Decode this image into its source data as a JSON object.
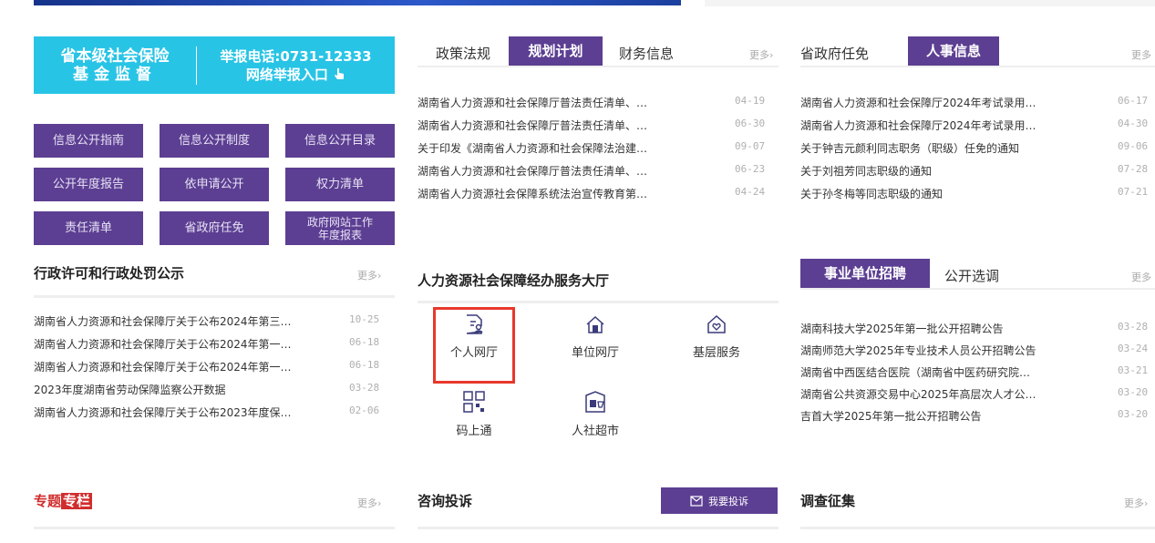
{
  "fund": {
    "line1": "省本级社会保险",
    "line2": "基金监督",
    "hotline": "举报电话:0731-12333",
    "report_entry": "网络举报入口"
  },
  "info_grid": [
    "信息公开指南",
    "信息公开制度",
    "信息公开目录",
    "公开年度报告",
    "依申请公开",
    "权力清单",
    "责任清单",
    "省政府任免",
    "政府网站工作",
    "年度报表"
  ],
  "policy": {
    "tabs": [
      "政策法规",
      "规划计划",
      "财务信息"
    ],
    "active": "规划计划",
    "more": "更多›",
    "items": [
      {
        "title": "湖南省人力资源和社会保障厅普法责任清单、…",
        "date": "04-19"
      },
      {
        "title": "湖南省人力资源和社会保障厅普法责任清单、…",
        "date": "06-30"
      },
      {
        "title": "关于印发《湖南省人力资源和社会保障法治建…",
        "date": "09-07"
      },
      {
        "title": "湖南省人力资源和社会保障厅普法责任清单、…",
        "date": "06-23"
      },
      {
        "title": "湖南省人力资源社会保障系统法治宣传教育第…",
        "date": "04-24"
      }
    ]
  },
  "personnel": {
    "tabs": [
      "省政府任免",
      "人事信息"
    ],
    "active": "人事信息",
    "more": "更多",
    "items": [
      {
        "title": "湖南省人力资源和社会保障厅2024年考试录用…",
        "date": "06-17"
      },
      {
        "title": "湖南省人力资源和社会保障厅2024年考试录用…",
        "date": "04-30"
      },
      {
        "title": "关于钟吉元颜利同志职务（职级）任免的通知",
        "date": "09-06"
      },
      {
        "title": "关于刘祖芳同志职级的通知",
        "date": "07-28"
      },
      {
        "title": "关于孙冬梅等同志职级的通知",
        "date": "07-21"
      }
    ]
  },
  "admin": {
    "title": "行政许可和行政处罚公示",
    "more": "更多›",
    "items": [
      {
        "title": "湖南省人力资源和社会保障厅关于公布2024年第三…",
        "date": "10-25"
      },
      {
        "title": "湖南省人力资源和社会保障厅关于公布2024年第一…",
        "date": "06-18"
      },
      {
        "title": "湖南省人力资源和社会保障厅关于公布2024年第一…",
        "date": "06-18"
      },
      {
        "title": "2023年度湖南省劳动保障监察公开数据",
        "date": "03-28"
      },
      {
        "title": "湖南省人力资源和社会保障厅关于公布2023年度保…",
        "date": "02-06"
      }
    ]
  },
  "service": {
    "title": "人力资源社会保障经办服务大厅",
    "items": [
      "个人网厅",
      "单位网厅",
      "基层服务",
      "码上通",
      "人社超市"
    ]
  },
  "recruit": {
    "tabs": [
      "事业单位招聘",
      "公开选调"
    ],
    "active": "事业单位招聘",
    "more": "更多",
    "items": [
      {
        "title": "湖南科技大学2025年第一批公开招聘公告",
        "date": "03-28"
      },
      {
        "title": "湖南师范大学2025年专业技术人员公开招聘公告",
        "date": "03-24"
      },
      {
        "title": "湖南省中西医结合医院（湖南省中医药研究院…",
        "date": "03-21"
      },
      {
        "title": "湖南省公共资源交易中心2025年高层次人才公…",
        "date": "03-20"
      },
      {
        "title": "吉首大学2025年第一批公开招聘公告",
        "date": "03-20"
      }
    ]
  },
  "bottom": {
    "special_a": "专题",
    "special_b": "专栏",
    "special_more": "更多›",
    "consult_title": "咨询投诉",
    "complain_btn": "我要投诉",
    "survey_title": "调查征集",
    "survey_more": "更多›"
  },
  "colors": {
    "purple": "#5c3f92",
    "cyan": "#28c4e6",
    "highlight": "#e8382b"
  }
}
